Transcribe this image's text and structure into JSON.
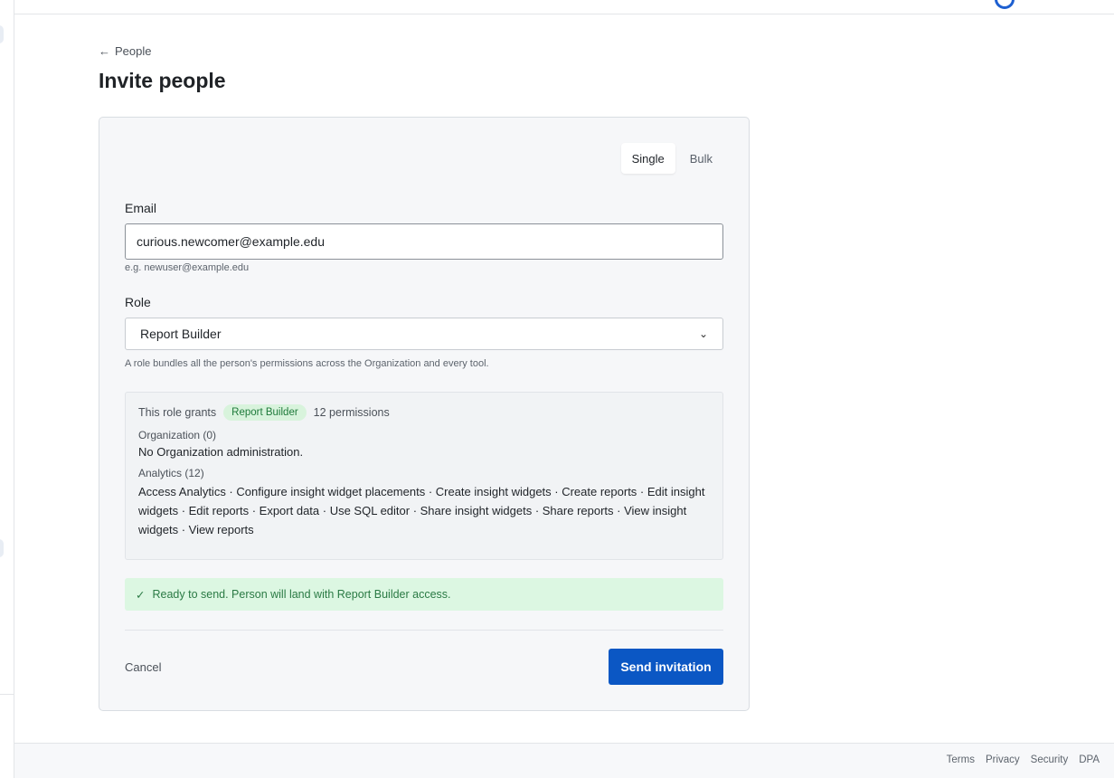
{
  "breadcrumb": {
    "back_label": "People"
  },
  "page": {
    "title": "Invite people"
  },
  "mode_toggle": {
    "single_label": "Single",
    "bulk_label": "Bulk",
    "selected": "Single"
  },
  "email": {
    "label": "Email",
    "value": "curious.newcomer@example.edu",
    "hint": "e.g. newuser@example.edu"
  },
  "role": {
    "label": "Role",
    "selected": "Report Builder",
    "hint": "A role bundles all the person's permissions across the Organization and every tool."
  },
  "grants": {
    "intro": "This role grants",
    "role_badge": "Report Builder",
    "count": "12 permissions",
    "sections": [
      {
        "title": "Organization (0)",
        "body": "No Organization administration."
      },
      {
        "title": "Analytics (12)",
        "body": "Access Analytics · Configure insight widget placements · Create insight widgets · Create reports · Edit insight widgets · Edit reports · Export data · Use SQL editor · Share insight widgets · Share reports · View insight widgets · View reports"
      }
    ]
  },
  "status": {
    "icon": "check-icon",
    "message": "Ready to send. Person will land with Report Builder access."
  },
  "actions": {
    "cancel_label": "Cancel",
    "send_label": "Send invitation"
  },
  "footer": {
    "links": [
      "Terms",
      "Privacy",
      "Security",
      "DPA"
    ]
  },
  "colors": {
    "primary": "#0b57c4",
    "success_bg": "#dcf7e2",
    "success_text": "#2a7a44",
    "badge_bg": "#d8f3dc"
  }
}
